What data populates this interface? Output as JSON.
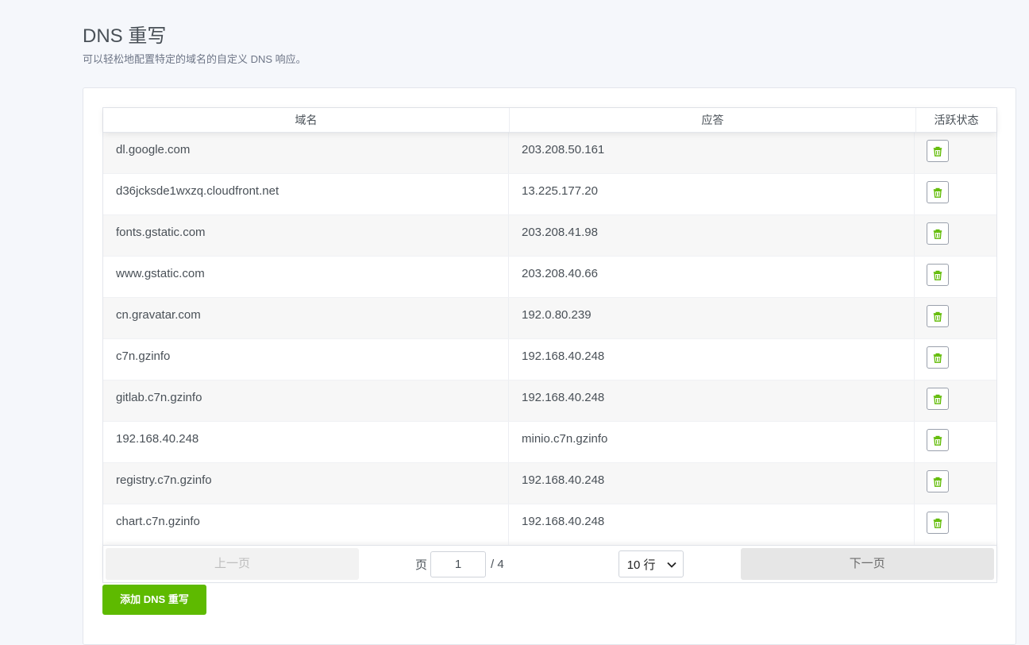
{
  "header": {
    "title": "DNS 重写",
    "subtitle": "可以轻松地配置特定的域名的自定义 DNS 响应。"
  },
  "table": {
    "columns": [
      "域名",
      "应答",
      "活跃状态"
    ],
    "rows": [
      {
        "domain": "dl.google.com",
        "answer": "203.208.50.161"
      },
      {
        "domain": "d36jcksde1wxzq.cloudfront.net",
        "answer": "13.225.177.20"
      },
      {
        "domain": "fonts.gstatic.com",
        "answer": "203.208.41.98"
      },
      {
        "domain": "www.gstatic.com",
        "answer": "203.208.40.66"
      },
      {
        "domain": "cn.gravatar.com",
        "answer": "192.0.80.239"
      },
      {
        "domain": "c7n.gzinfo",
        "answer": "192.168.40.248"
      },
      {
        "domain": "gitlab.c7n.gzinfo",
        "answer": "192.168.40.248"
      },
      {
        "domain": "192.168.40.248",
        "answer": "minio.c7n.gzinfo"
      },
      {
        "domain": "registry.c7n.gzinfo",
        "answer": "192.168.40.248"
      },
      {
        "domain": "chart.c7n.gzinfo",
        "answer": "192.168.40.248"
      }
    ],
    "row_action_icon": "trash-icon"
  },
  "pagination": {
    "prev_label": "上一页",
    "page_label": "页",
    "current_page": "1",
    "total_pages": "/ 4",
    "rows_per_page": "10 行",
    "next_label": "下一页"
  },
  "actions": {
    "add_label": "添加 DNS 重写"
  },
  "colors": {
    "accent": "#5eba00",
    "trash_icon": "#5eba00"
  }
}
